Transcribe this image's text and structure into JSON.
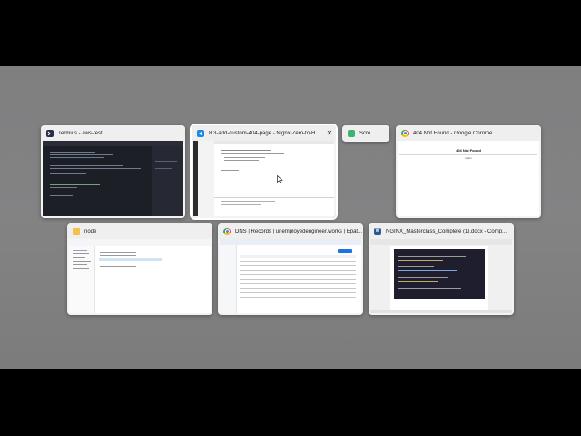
{
  "switcher": {
    "windows": [
      {
        "id": "termius",
        "title": "Termius - aws-test",
        "icon": "termius-icon",
        "accent": "#2a2f45"
      },
      {
        "id": "vscode",
        "title": "8.3-add-custom-404-page - Nignx-Zero-to-Her...",
        "icon": "vscode-icon",
        "accent": "#1e88e5",
        "close": "✕"
      },
      {
        "id": "snip",
        "title": "Scre...",
        "icon": "snipping-tool-icon",
        "accent": "#3cb371"
      },
      {
        "id": "chrome404",
        "title": "404 Not Found - Google Chrome",
        "icon": "chrome-icon",
        "accent": "#e53935",
        "page_heading": "404 Not Found",
        "page_footer": "nginx"
      },
      {
        "id": "explorer",
        "title": "node",
        "icon": "folder-icon",
        "accent": "#f2c14e"
      },
      {
        "id": "chromedns",
        "title": "DNS | Records | unemployedengineer.works | Epat...",
        "icon": "chrome-icon",
        "accent": "#e53935"
      },
      {
        "id": "word",
        "title": "NGINX_Masterclass_Complete (1).docx  -  Comp...",
        "icon": "word-icon",
        "accent": "#2b5797"
      }
    ]
  }
}
